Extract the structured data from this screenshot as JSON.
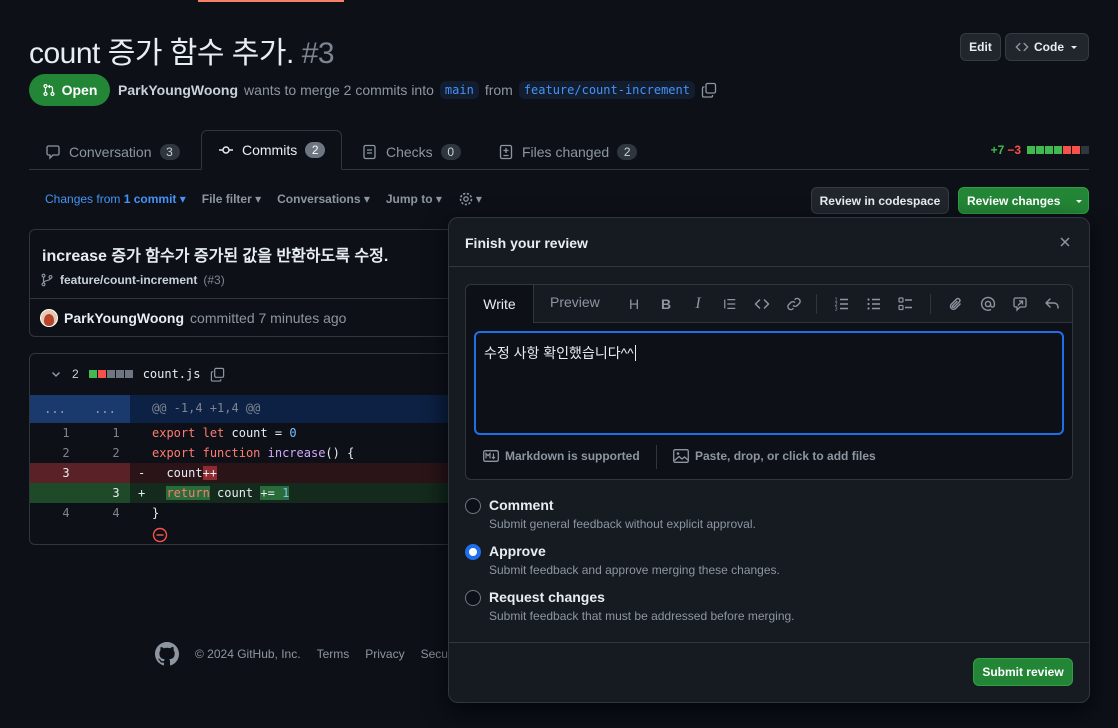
{
  "header": {
    "title": "count 증가 함수 추가.",
    "number": "#3",
    "edit_label": "Edit",
    "code_label": "Code"
  },
  "status": {
    "badge": "Open",
    "author": "ParkYoungWoong",
    "text_a": "wants to merge 2 commits into",
    "base_branch": "main",
    "text_b": "from",
    "head_branch": "feature/count-increment"
  },
  "tabs": [
    {
      "label": "Conversation",
      "count": "3"
    },
    {
      "label": "Commits",
      "count": "2"
    },
    {
      "label": "Checks",
      "count": "0"
    },
    {
      "label": "Files changed",
      "count": "2"
    }
  ],
  "diffstat": {
    "additions": "+7",
    "deletions": "−3"
  },
  "toolbar": {
    "changes_prefix": "Changes from",
    "changes_bold": "1 commit",
    "file_filter": "File filter",
    "conversations": "Conversations",
    "jump_to": "Jump to",
    "review_codespace": "Review in codespace",
    "review_changes": "Review changes"
  },
  "commit": {
    "title": "increase 증가 함수가 증가된 값을 반환하도록 수정.",
    "branch": "feature/count-increment",
    "pr_ref": "(#3)",
    "author": "ParkYoungWoong",
    "action": "committed 7 minutes ago"
  },
  "file": {
    "changes": "2",
    "name": "count.js",
    "hunk_gutter": "...",
    "hunk_header": "@@ -1,4 +1,4 @@",
    "lines": [
      {
        "old": "1",
        "new": "1",
        "sign": "",
        "kind": "ctx"
      },
      {
        "old": "2",
        "new": "2",
        "sign": "",
        "kind": "ctx"
      },
      {
        "old": "3",
        "new": "",
        "sign": "-",
        "kind": "del"
      },
      {
        "old": "",
        "new": "3",
        "sign": "+",
        "kind": "add"
      },
      {
        "old": "4",
        "new": "4",
        "sign": "",
        "kind": "ctx"
      }
    ],
    "code": {
      "l1_kw1": "export",
      "l1_kw2": "let",
      "l1_var": " count = ",
      "l1_num": "0",
      "l2_kw1": "export",
      "l2_kw2": "function",
      "l2_fn": "increase",
      "l2_rest": "() {",
      "l3_a": "  count",
      "l3_hl": "++",
      "l4_a": "  ",
      "l4_kw": "return",
      "l4_b": " count ",
      "l4_hl": "+= ",
      "l4_num": "1",
      "l5": "}"
    }
  },
  "footer": {
    "copyright": "© 2024 GitHub, Inc.",
    "links": [
      "Terms",
      "Privacy",
      "Secu"
    ]
  },
  "review": {
    "title": "Finish your review",
    "write_tab": "Write",
    "preview_tab": "Preview",
    "comment_text": "수정 사항 확인했습니다^^",
    "markdown_note": "Markdown is supported",
    "attach_note": "Paste, drop, or click to add files",
    "options": [
      {
        "label": "Comment",
        "desc": "Submit general feedback without explicit approval.",
        "checked": false
      },
      {
        "label": "Approve",
        "desc": "Submit feedback and approve merging these changes.",
        "checked": true
      },
      {
        "label": "Request changes",
        "desc": "Submit feedback that must be addressed before merging.",
        "checked": false
      }
    ],
    "submit_label": "Submit review"
  },
  "colors": {
    "accent_green": "#238636",
    "link_blue": "#4493f8",
    "focus_blue": "#1f6feb",
    "add_green": "#3fb950",
    "del_red": "#f85149"
  }
}
